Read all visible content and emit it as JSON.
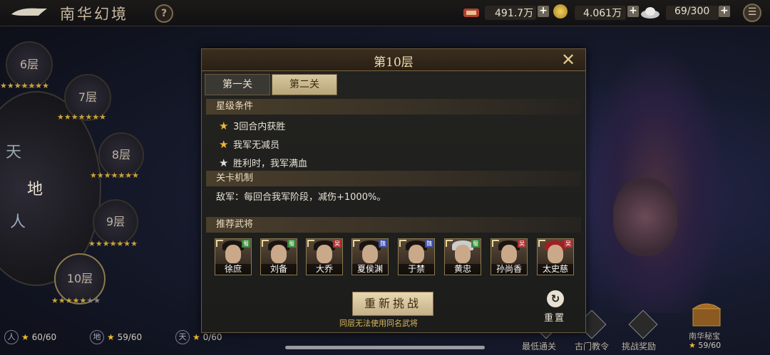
{
  "topbar": {
    "title": "南华幻境",
    "help": "?",
    "resource1": "491.7万",
    "resource2": "4.061万",
    "resource3": "69/300"
  },
  "floors": [
    {
      "label": "6层"
    },
    {
      "label": "7层"
    },
    {
      "label": "8层"
    },
    {
      "label": "9层"
    },
    {
      "label": "10层"
    }
  ],
  "wheel": {
    "seg1": "天",
    "seg2": "地",
    "seg3": "人"
  },
  "bottom_stats": [
    {
      "icon": "人",
      "value": "60/60"
    },
    {
      "icon": "地",
      "value": "59/60"
    },
    {
      "icon": "天",
      "value": "0/60"
    }
  ],
  "bottom_buttons": [
    {
      "label": "最低通关"
    },
    {
      "label": "古门教令"
    },
    {
      "label": "挑战奖励"
    },
    {
      "label": "南华秘宝"
    }
  ],
  "treasure_count": "59/60",
  "dialog": {
    "title": "第10层",
    "tabs": [
      "第一关",
      "第二关"
    ],
    "star_section": "星级条件",
    "conditions": [
      {
        "text": "3回合内获胜",
        "star": "gold"
      },
      {
        "text": "我军无减员",
        "star": "gold"
      },
      {
        "text": "胜利时，我军满血",
        "star": "silver"
      }
    ],
    "mech_section": "关卡机制",
    "mech_text": "敌军：每回合我军阶段，减伤+1000%。",
    "hero_section": "推荐武将",
    "heroes": [
      {
        "name": "徐庶",
        "faction": "蜀",
        "color": "#3a8a3a"
      },
      {
        "name": "刘备",
        "faction": "蜀",
        "color": "#3a8a3a"
      },
      {
        "name": "大乔",
        "faction": "吴",
        "color": "#b03030"
      },
      {
        "name": "夏侯渊",
        "faction": "魏",
        "color": "#3a4aa0"
      },
      {
        "name": "于禁",
        "faction": "魏",
        "color": "#3a4aa0"
      },
      {
        "name": "黄忠",
        "faction": "蜀",
        "color": "#3a8a3a"
      },
      {
        "name": "孙尚香",
        "faction": "吴",
        "color": "#b03030"
      },
      {
        "name": "太史慈",
        "faction": "吴",
        "color": "#b03030"
      }
    ],
    "restart_label": "重新挑战",
    "restart_note": "同层无法使用同名武将",
    "reset_label": "重置"
  }
}
